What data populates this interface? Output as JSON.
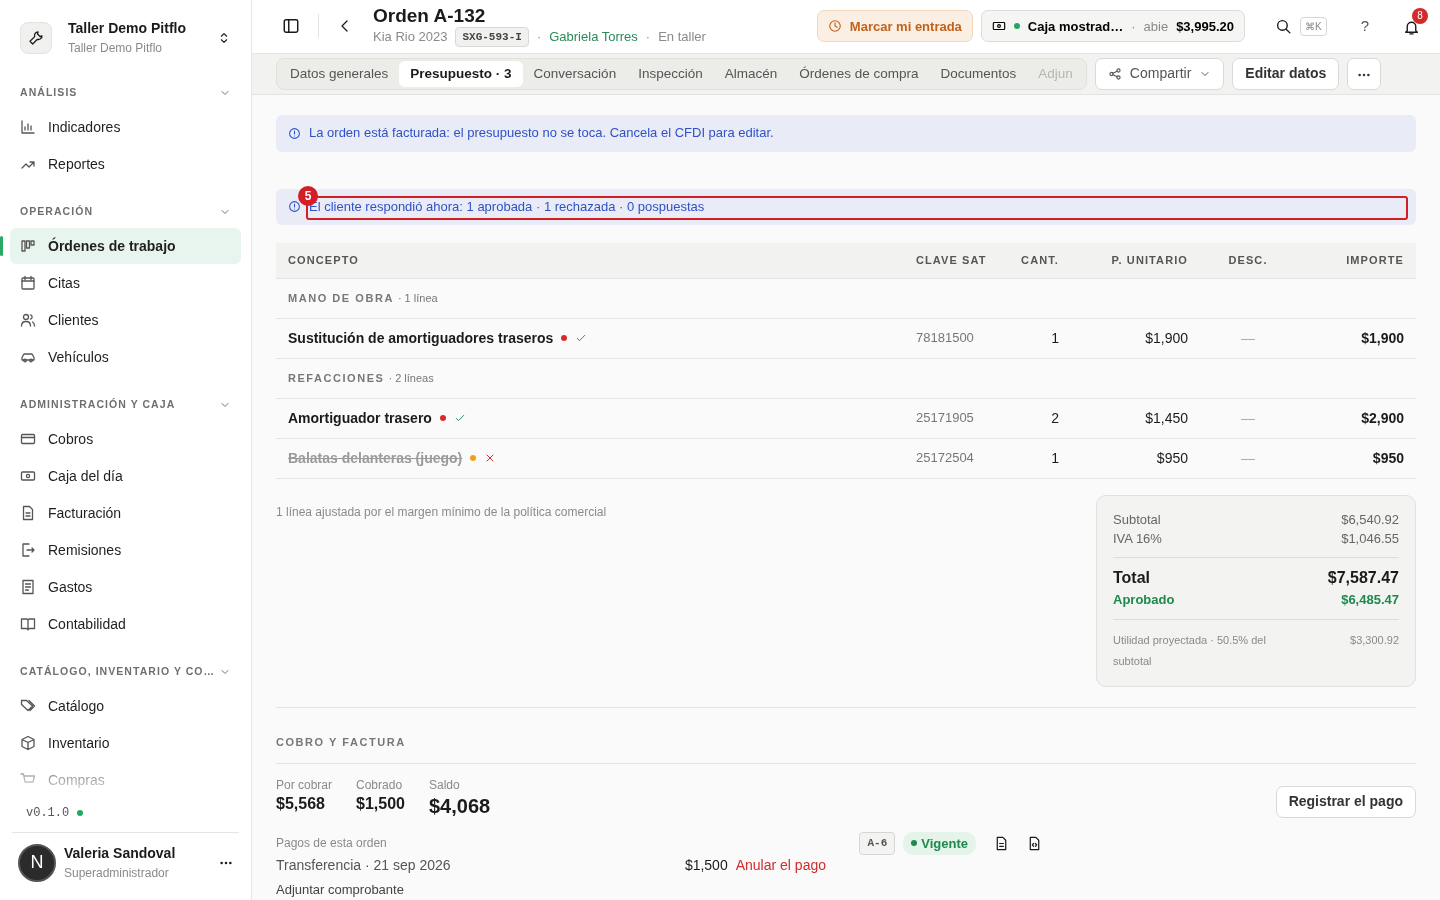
{
  "sidebar": {
    "workspace": {
      "name": "Taller Demo Pitflo",
      "subtitle": "Taller Demo Pitflo"
    },
    "sections": [
      {
        "title": "ANÁLISIS",
        "expanded": true,
        "items": [
          {
            "label": "Indicadores",
            "selected": false
          },
          {
            "label": "Reportes",
            "selected": false
          }
        ]
      },
      {
        "title": "OPERACIÓN",
        "expanded": true,
        "items": [
          {
            "label": "Órdenes de trabajo",
            "selected": true
          },
          {
            "label": "Citas",
            "selected": false
          },
          {
            "label": "Clientes",
            "selected": false
          },
          {
            "label": "Vehículos",
            "selected": false
          }
        ]
      },
      {
        "title": "ADMINISTRACIÓN Y CAJA",
        "expanded": true,
        "items": [
          {
            "label": "Cobros",
            "selected": false
          },
          {
            "label": "Caja del día",
            "selected": false
          },
          {
            "label": "Facturación",
            "selected": false
          },
          {
            "label": "Remisiones",
            "selected": false
          },
          {
            "label": "Gastos",
            "selected": false
          },
          {
            "label": "Contabilidad",
            "selected": false
          }
        ]
      },
      {
        "title": "CATÁLOGO, INVENTARIO Y CO…",
        "expanded": true,
        "items": [
          {
            "label": "Catálogo",
            "selected": false
          },
          {
            "label": "Inventario",
            "selected": false
          },
          {
            "label": "Compras",
            "selected": false
          }
        ]
      }
    ],
    "version": {
      "label": "v0.1.0",
      "color": "#22a861"
    },
    "user": {
      "initial": "N",
      "name": "Valeria Sandoval",
      "role": "Superadministrador"
    }
  },
  "header": {
    "title": "Orden A-132",
    "vehicle": "Kia Rio 2023",
    "plate": "SXG-593-I",
    "separators": [
      "·",
      "·"
    ],
    "customer": "Gabriela Torres",
    "status": "En taller",
    "clock_button": "Marcar mi entrada",
    "cash": {
      "name": "Caja mostrad…",
      "separator": "·",
      "state": "abie",
      "amount": "$3,995.20",
      "color": "#22a861"
    },
    "shortcut": "⌘K",
    "help": "?",
    "notifications": "8"
  },
  "tabs": [
    {
      "label": "Datos generales",
      "selected": false
    },
    {
      "label": "Presupuesto · 3",
      "selected": true
    },
    {
      "label": "Conversación",
      "selected": false
    },
    {
      "label": "Inspección",
      "selected": false
    },
    {
      "label": "Almacén",
      "selected": false
    },
    {
      "label": "Órdenes de compra",
      "selected": false
    },
    {
      "label": "Documentos",
      "selected": false
    },
    {
      "label": "Adjun",
      "selected": false
    }
  ],
  "actions": {
    "share": "Compartir",
    "edit": "Editar datos"
  },
  "alerts": [
    {
      "text": "La orden está facturada: el presupuesto no se toca. Cancela el CFDI para editar."
    },
    {
      "text": "El cliente respondió ahora: 1 aprobada · 1 rechazada · 0 pospuestas",
      "annotation": "5"
    }
  ],
  "table": {
    "columns": [
      "CONCEPTO",
      "CLAVE SAT",
      "CANT.",
      "P. UNITARIO",
      "DESC.",
      "IMPORTE"
    ],
    "groups": [
      {
        "title": "MANO DE OBRA",
        "count": "· 1 línea",
        "rows": [
          {
            "concept": "Sustitución de amortiguadores traseros",
            "color": "#d62b2b",
            "rejected": false,
            "sat": "78181500",
            "qty": "1",
            "unit": "$1,900",
            "discount": "—",
            "amount": "$1,900"
          }
        ]
      },
      {
        "title": "REFACCIONES",
        "count": "· 2 líneas",
        "rows": [
          {
            "concept": "Amortiguador trasero",
            "color": "#d62b2b",
            "rejected": false,
            "sat": "25171905",
            "qty": "2",
            "unit": "$1,450",
            "discount": "—",
            "amount": "$2,900"
          },
          {
            "concept": "Balatas delanteras (juego)",
            "color": "#f0a020",
            "rejected": true,
            "sat": "25172504",
            "qty": "1",
            "unit": "$950",
            "discount": "—",
            "amount": "$950"
          }
        ]
      }
    ]
  },
  "note": "1 línea ajustada por el margen mínimo de la política comercial",
  "summary": {
    "subtotal_label": "Subtotal",
    "subtotal": "$6,540.92",
    "tax_label": "IVA 16%",
    "tax": "$1,046.55",
    "total_label": "Total",
    "total": "$7,587.47",
    "approved_label": "Aprobado",
    "approved": "$6,485.47",
    "profit_label": "Utilidad proyectada · 50.5% del subtotal",
    "profit": "$3,300.92"
  },
  "billing": {
    "title": "COBRO Y FACTURA",
    "stats": [
      {
        "label": "Por cobrar",
        "value": "$5,568",
        "emphasis": false
      },
      {
        "label": "Cobrado",
        "value": "$1,500",
        "emphasis": false
      },
      {
        "label": "Saldo",
        "value": "$4,068",
        "emphasis": true
      }
    ],
    "register_button": "Registrar el pago",
    "payments_title": "Pagos de esta orden",
    "payment": {
      "method": "Transferencia · 21 sep 2026",
      "amount": "$1,500",
      "cancel": "Anular el pago",
      "folio": "A-6",
      "status": "Vigente"
    },
    "attach": "Adjuntar comprobante"
  }
}
